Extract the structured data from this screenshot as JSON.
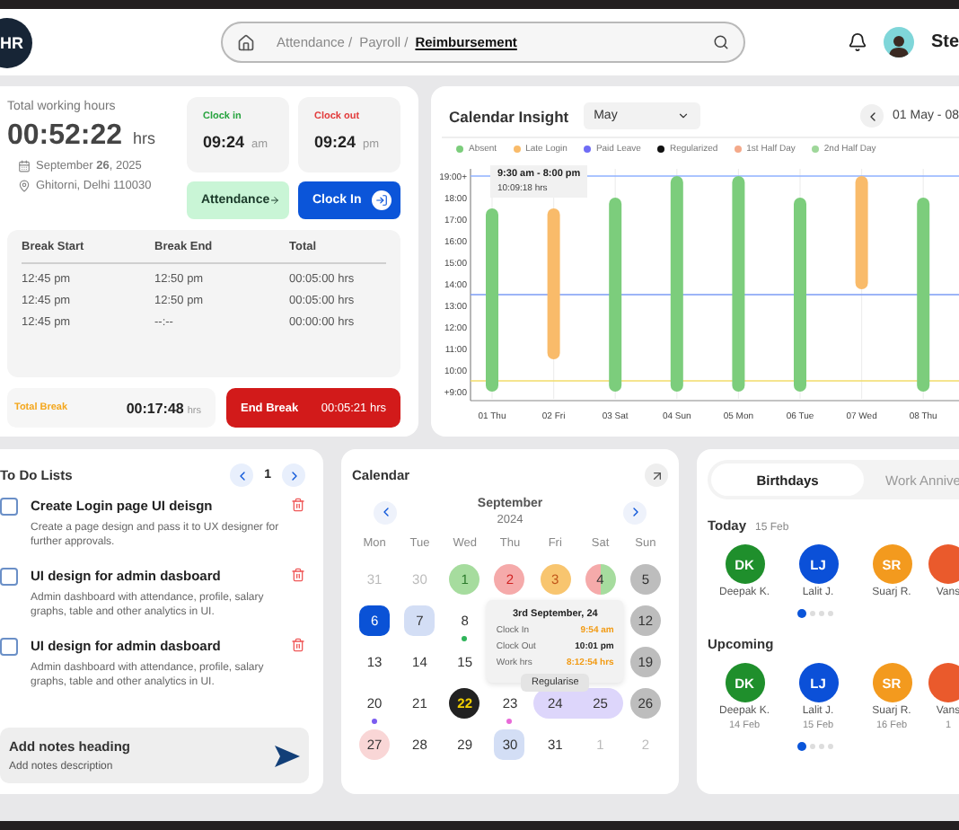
{
  "header": {
    "logo": "HR",
    "breadcrumb": [
      {
        "label": "Attendance /",
        "current": false
      },
      {
        "label": "Payroll /",
        "current": false
      },
      {
        "label": "Reimbursement",
        "current": true
      }
    ],
    "user": "Ste"
  },
  "working": {
    "title": "Total working hours",
    "time": "00:52:22",
    "unit": "hrs",
    "date": "September **26**, 2025",
    "location": "Ghitorni, Delhi 110030",
    "clocks": [
      {
        "label": "Clock in",
        "time": "09:24",
        "period": "am",
        "kind": "in"
      },
      {
        "label": "Clock out",
        "time": "09:24",
        "period": "pm",
        "kind": "out"
      }
    ],
    "actions": [
      {
        "label": "Attendance",
        "kind": "attendance"
      },
      {
        "label": "Clock In",
        "kind": "clock"
      }
    ],
    "breaks": {
      "columns": [
        "Break Start",
        "Break End",
        "Total"
      ],
      "rows": [
        [
          "12:45 pm",
          "12:50 pm",
          "00:05:00 hrs"
        ],
        [
          "12:45 pm",
          "12:50 pm",
          "00:05:00 hrs"
        ],
        [
          "12:45 pm",
          "--:--",
          "00:00:00 hrs"
        ]
      ]
    },
    "total_break": {
      "label": "Total Break",
      "time": "00:17:48",
      "unit": "hrs"
    },
    "end_break": {
      "label": "End Break",
      "time": "00:05:21 hrs"
    }
  },
  "insight": {
    "title": "Calendar Insight",
    "month": "May",
    "range": "01 May - 08",
    "tooltip": {
      "range": "9:30 am - 8:00 pm",
      "hours": "10:09:18 hrs"
    },
    "chart_data": {
      "type": "candlestick",
      "categories": [
        "01 Thu",
        "02 Fri",
        "03 Sat",
        "04 Sun",
        "05 Mon",
        "06 Tue",
        "07 Wed",
        "08 Thu"
      ],
      "series": [
        {
          "name": "Absent",
          "color": "#7ccd7c",
          "ohlc": [
            [
              9,
              17.5,
              9,
              17.5
            ],
            null,
            [
              9,
              18,
              9,
              18
            ],
            [
              9,
              19,
              9,
              19
            ],
            [
              9,
              19,
              9,
              19
            ],
            [
              9,
              18,
              9,
              18
            ],
            null,
            [
              9,
              18,
              9,
              18
            ]
          ]
        },
        {
          "name": "Late Login",
          "color": "#f9bb6a",
          "ohlc": [
            null,
            [
              10.5,
              17.5,
              10.5,
              17.5
            ],
            null,
            null,
            null,
            null,
            [
              13.75,
              19,
              13.75,
              19
            ],
            null
          ]
        },
        {
          "name": "Paid Leave",
          "color": "#6f6cf5",
          "ohlc": [
            null,
            null,
            null,
            null,
            null,
            null,
            null,
            null
          ]
        },
        {
          "name": "Regularized",
          "color": "#111111",
          "ohlc": [
            null,
            null,
            null,
            null,
            null,
            null,
            null,
            null
          ]
        },
        {
          "name": "1st Half Day",
          "color": "#f4a98a",
          "ohlc": [
            null,
            null,
            null,
            null,
            null,
            null,
            null,
            null
          ]
        },
        {
          "name": "2nd Half Day",
          "color": "#9fd79a",
          "ohlc": [
            null,
            null,
            null,
            null,
            null,
            null,
            null,
            null
          ]
        }
      ],
      "ylim": [
        9,
        19
      ],
      "yticks": [
        {
          "value": 9,
          "label": "+9:00"
        },
        {
          "value": 10,
          "label": "10:00"
        },
        {
          "value": 11,
          "label": "11:00"
        },
        {
          "value": 12,
          "label": "12:00"
        },
        {
          "value": 13,
          "label": "13:00"
        },
        {
          "value": 14,
          "label": "14:00"
        },
        {
          "value": 15,
          "label": "15:00"
        },
        {
          "value": 16,
          "label": "16:00"
        },
        {
          "value": 17,
          "label": "17:00"
        },
        {
          "value": 18,
          "label": "18:00"
        },
        {
          "value": 19,
          "label": "19:00+"
        }
      ],
      "grid": true,
      "ref_lines": [
        {
          "axis": "y",
          "value": 19
        },
        {
          "axis": "y",
          "value": 13.5
        },
        {
          "axis": "y",
          "value": 9.5
        }
      ]
    }
  },
  "todo": {
    "title": "To Do Lists",
    "page": "1",
    "items": [
      {
        "title": "Create Login page UI deisgn",
        "description": "Create a page design and pass it to UX designer for further approvals.",
        "checked": false
      },
      {
        "title": "UI design for admin dasboard",
        "description": "Admin dashboard with attendance, profile, salary graphs, table and other analytics in UI.",
        "checked": false
      },
      {
        "title": "UI design for admin dasboard",
        "description": "Admin dashboard with attendance, profile, salary graphs, table and other analytics in UI.",
        "checked": false
      }
    ],
    "notes": {
      "heading": "Add notes heading",
      "description": "Add notes description"
    }
  },
  "calendar": {
    "title": "Calendar",
    "month": "September",
    "year": "2024",
    "weekdays": [
      "Mon",
      "Tue",
      "Wed",
      "Thu",
      "Fri",
      "Sat",
      "Sun"
    ],
    "days": [
      {
        "day": "31",
        "kind": "muted"
      },
      {
        "day": "30",
        "kind": "muted"
      },
      {
        "day": "1",
        "kind": "present"
      },
      {
        "day": "2",
        "kind": "absent"
      },
      {
        "day": "3",
        "kind": "late"
      },
      {
        "day": "4",
        "kind": "half"
      },
      {
        "day": "5",
        "kind": "weekend"
      },
      {
        "day": "6",
        "kind": "today"
      },
      {
        "day": "7",
        "kind": "selected"
      },
      {
        "day": "8",
        "kind": "dot",
        "color": "#2fb45a"
      },
      {
        "day": "12",
        "kind": "weekend"
      },
      {
        "day": "13",
        "kind": "plain"
      },
      {
        "day": "14",
        "kind": "plain"
      },
      {
        "day": "15",
        "kind": "plain"
      },
      {
        "day": "19",
        "kind": "weekend"
      },
      {
        "day": "20",
        "kind": "dot",
        "color": "#7b5cf0"
      },
      {
        "day": "21",
        "kind": "plain"
      },
      {
        "day": "22",
        "kind": "holiday"
      },
      {
        "day": "23",
        "kind": "dot",
        "color": "#e86ad8"
      },
      {
        "day": "24",
        "kind": "leavestart"
      },
      {
        "day": "25",
        "kind": "leaveend"
      },
      {
        "day": "26",
        "kind": "weekend"
      },
      {
        "day": "27",
        "kind": "pending"
      },
      {
        "day": "28",
        "kind": "plain"
      },
      {
        "day": "29",
        "kind": "plain"
      },
      {
        "day": "30",
        "kind": "selected"
      },
      {
        "day": "31",
        "kind": "plain"
      },
      {
        "day": "1",
        "kind": "muted"
      },
      {
        "day": "2",
        "kind": "muted"
      }
    ],
    "popover": {
      "title": "3rd September, 24",
      "rows": [
        {
          "label": "Clock In",
          "value": "9:54 am",
          "highlight": true
        },
        {
          "label": "Clock Out",
          "value": "10:01 pm",
          "highlight": false
        },
        {
          "label": "Work hrs",
          "value": "8:12:54 hrs",
          "highlight": true
        }
      ],
      "button": "Regularise"
    }
  },
  "birthdays": {
    "tabs": [
      {
        "label": "Birthdays",
        "selected": true
      },
      {
        "label": "Work Annive",
        "selected": false
      }
    ],
    "groups": [
      {
        "title": "Today",
        "date": "15 Feb",
        "people": [
          {
            "initials": "DK",
            "name": "Deepak K.",
            "color": "#1f8f2c"
          },
          {
            "initials": "LJ",
            "name": "Lalit J.",
            "color": "#0b50d8"
          },
          {
            "initials": "SR",
            "name": "Suarj R.",
            "color": "#f39a1e"
          },
          {
            "name": "Vans",
            "color": "#ea5a2c"
          }
        ],
        "pages": [
          {
            "selected": true
          },
          {
            "selected": false
          },
          {
            "selected": false
          },
          {
            "selected": false
          }
        ]
      },
      {
        "title": "Upcoming",
        "people": [
          {
            "initials": "DK",
            "name": "Deepak K.",
            "date": "14 Feb",
            "color": "#1f8f2c"
          },
          {
            "initials": "LJ",
            "name": "Lalit J.",
            "date": "15 Feb",
            "color": "#0b50d8"
          },
          {
            "initials": "SR",
            "name": "Suarj R.",
            "date": "16 Feb",
            "color": "#f39a1e"
          },
          {
            "name": "Vans",
            "date": "1",
            "color": "#ea5a2c"
          }
        ],
        "pages": [
          {
            "selected": true
          },
          {
            "selected": false
          },
          {
            "selected": false
          },
          {
            "selected": false
          }
        ]
      }
    ]
  }
}
